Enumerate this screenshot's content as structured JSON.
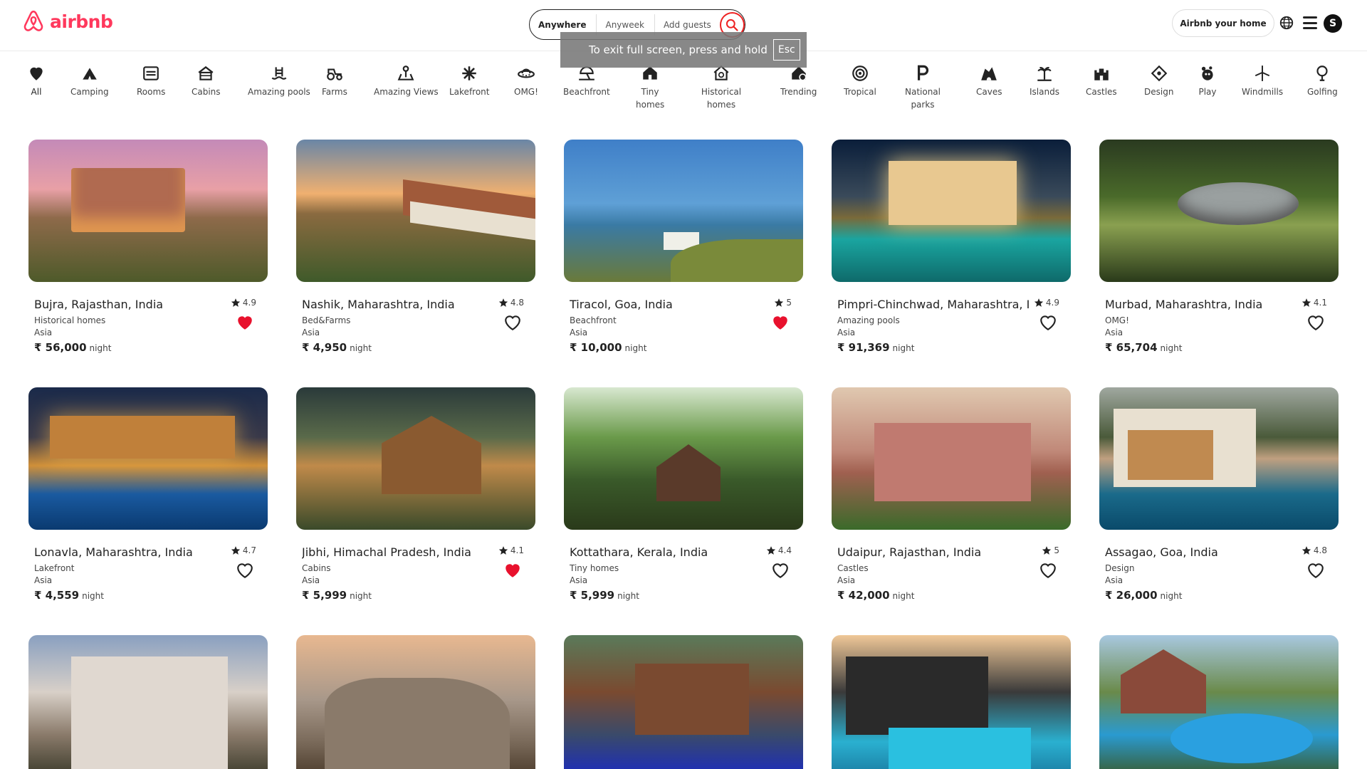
{
  "brand": {
    "name": "airbnb",
    "color": "#ff385c"
  },
  "search": {
    "where": "Anywhere",
    "when": "Anyweek",
    "guests": "Add guests",
    "icon": "search-icon"
  },
  "fullscreen_banner": {
    "text": "To exit full screen, press and hold",
    "key": "Esc"
  },
  "header_right": {
    "host_label": "Airbnb your home",
    "globe_icon": "globe-icon",
    "menu_icon": "menu-icon",
    "avatar_letter": "S"
  },
  "categories": [
    {
      "label": "All",
      "icon": "heart-map-icon"
    },
    {
      "label": "Camping",
      "icon": "tent-icon"
    },
    {
      "label": "Rooms",
      "icon": "bed-icon"
    },
    {
      "label": "Cabins",
      "icon": "cabin-icon"
    },
    {
      "label": "Amazing pools",
      "icon": "pool-icon"
    },
    {
      "label": "Farms",
      "icon": "tractor-icon"
    },
    {
      "label": "Amazing Views",
      "icon": "view-icon"
    },
    {
      "label": "Lakefront",
      "icon": "lake-icon"
    },
    {
      "label": "OMG!",
      "icon": "ufo-icon"
    },
    {
      "label": "Beachfront",
      "icon": "beach-icon"
    },
    {
      "label": "Tiny homes",
      "icon": "tiny-home-icon"
    },
    {
      "label": "Historical homes",
      "icon": "historical-home-icon"
    },
    {
      "label": "Trending",
      "icon": "trending-icon"
    },
    {
      "label": "Tropical",
      "icon": "tropical-icon"
    },
    {
      "label": "National parks",
      "icon": "parking-icon"
    },
    {
      "label": "Caves",
      "icon": "cave-icon"
    },
    {
      "label": "Islands",
      "icon": "island-icon"
    },
    {
      "label": "Castles",
      "icon": "castle-icon"
    },
    {
      "label": "Design",
      "icon": "design-icon"
    },
    {
      "label": "Play",
      "icon": "play-icon"
    },
    {
      "label": "Windmills",
      "icon": "windmill-icon"
    },
    {
      "label": "Golfing",
      "icon": "golf-icon"
    }
  ],
  "listings": [
    {
      "title": "Bujra, Rajasthan, India",
      "category": "Historical homes",
      "region": "Asia",
      "price": "₹ 56,000",
      "unit": "night",
      "rating": "4.9",
      "favorited": true
    },
    {
      "title": "Nashik, Maharashtra, India",
      "category": "Bed&Farms",
      "region": "Asia",
      "price": "₹ 4,950",
      "unit": "night",
      "rating": "4.8",
      "favorited": false
    },
    {
      "title": "Tiracol, Goa, India",
      "category": "Beachfront",
      "region": "Asia",
      "price": "₹ 10,000",
      "unit": "night",
      "rating": "5",
      "favorited": true
    },
    {
      "title": "Pimpri-Chinchwad, Maharashtra, India",
      "category": "Amazing pools",
      "region": "Asia",
      "price": "₹ 91,369",
      "unit": "night",
      "rating": "4.9",
      "favorited": false
    },
    {
      "title": "Murbad, Maharashtra, India",
      "category": "OMG!",
      "region": "Asia",
      "price": "₹ 65,704",
      "unit": "night",
      "rating": "4.1",
      "favorited": false
    },
    {
      "title": "Lonavla, Maharashtra, India",
      "category": "Lakefront",
      "region": "Asia",
      "price": "₹ 4,559",
      "unit": "night",
      "rating": "4.7",
      "favorited": false
    },
    {
      "title": "Jibhi, Himachal Pradesh, India",
      "category": "Cabins",
      "region": "Asia",
      "price": "₹ 5,999",
      "unit": "night",
      "rating": "4.1",
      "favorited": true
    },
    {
      "title": "Kottathara, Kerala, India",
      "category": "Tiny homes",
      "region": "Asia",
      "price": "₹ 5,999",
      "unit": "night",
      "rating": "4.4",
      "favorited": false
    },
    {
      "title": "Udaipur, Rajasthan, India",
      "category": "Castles",
      "region": "Asia",
      "price": "₹ 42,000",
      "unit": "night",
      "rating": "5",
      "favorited": false
    },
    {
      "title": "Assagao, Goa, India",
      "category": "Design",
      "region": "Asia",
      "price": "₹ 26,000",
      "unit": "night",
      "rating": "4.8",
      "favorited": false
    },
    {
      "title": "",
      "category": "",
      "region": "",
      "price": "",
      "unit": "",
      "rating": "",
      "favorited": false
    },
    {
      "title": "",
      "category": "",
      "region": "",
      "price": "",
      "unit": "",
      "rating": "",
      "favorited": false
    },
    {
      "title": "",
      "category": "",
      "region": "",
      "price": "",
      "unit": "",
      "rating": "",
      "favorited": false
    },
    {
      "title": "",
      "category": "",
      "region": "",
      "price": "",
      "unit": "",
      "rating": "",
      "favorited": false
    },
    {
      "title": "",
      "category": "",
      "region": "",
      "price": "",
      "unit": "",
      "rating": "",
      "favorited": false
    }
  ],
  "colors": {
    "heart_filled": "#e8112d",
    "text": "#222222",
    "muted": "#444444"
  }
}
